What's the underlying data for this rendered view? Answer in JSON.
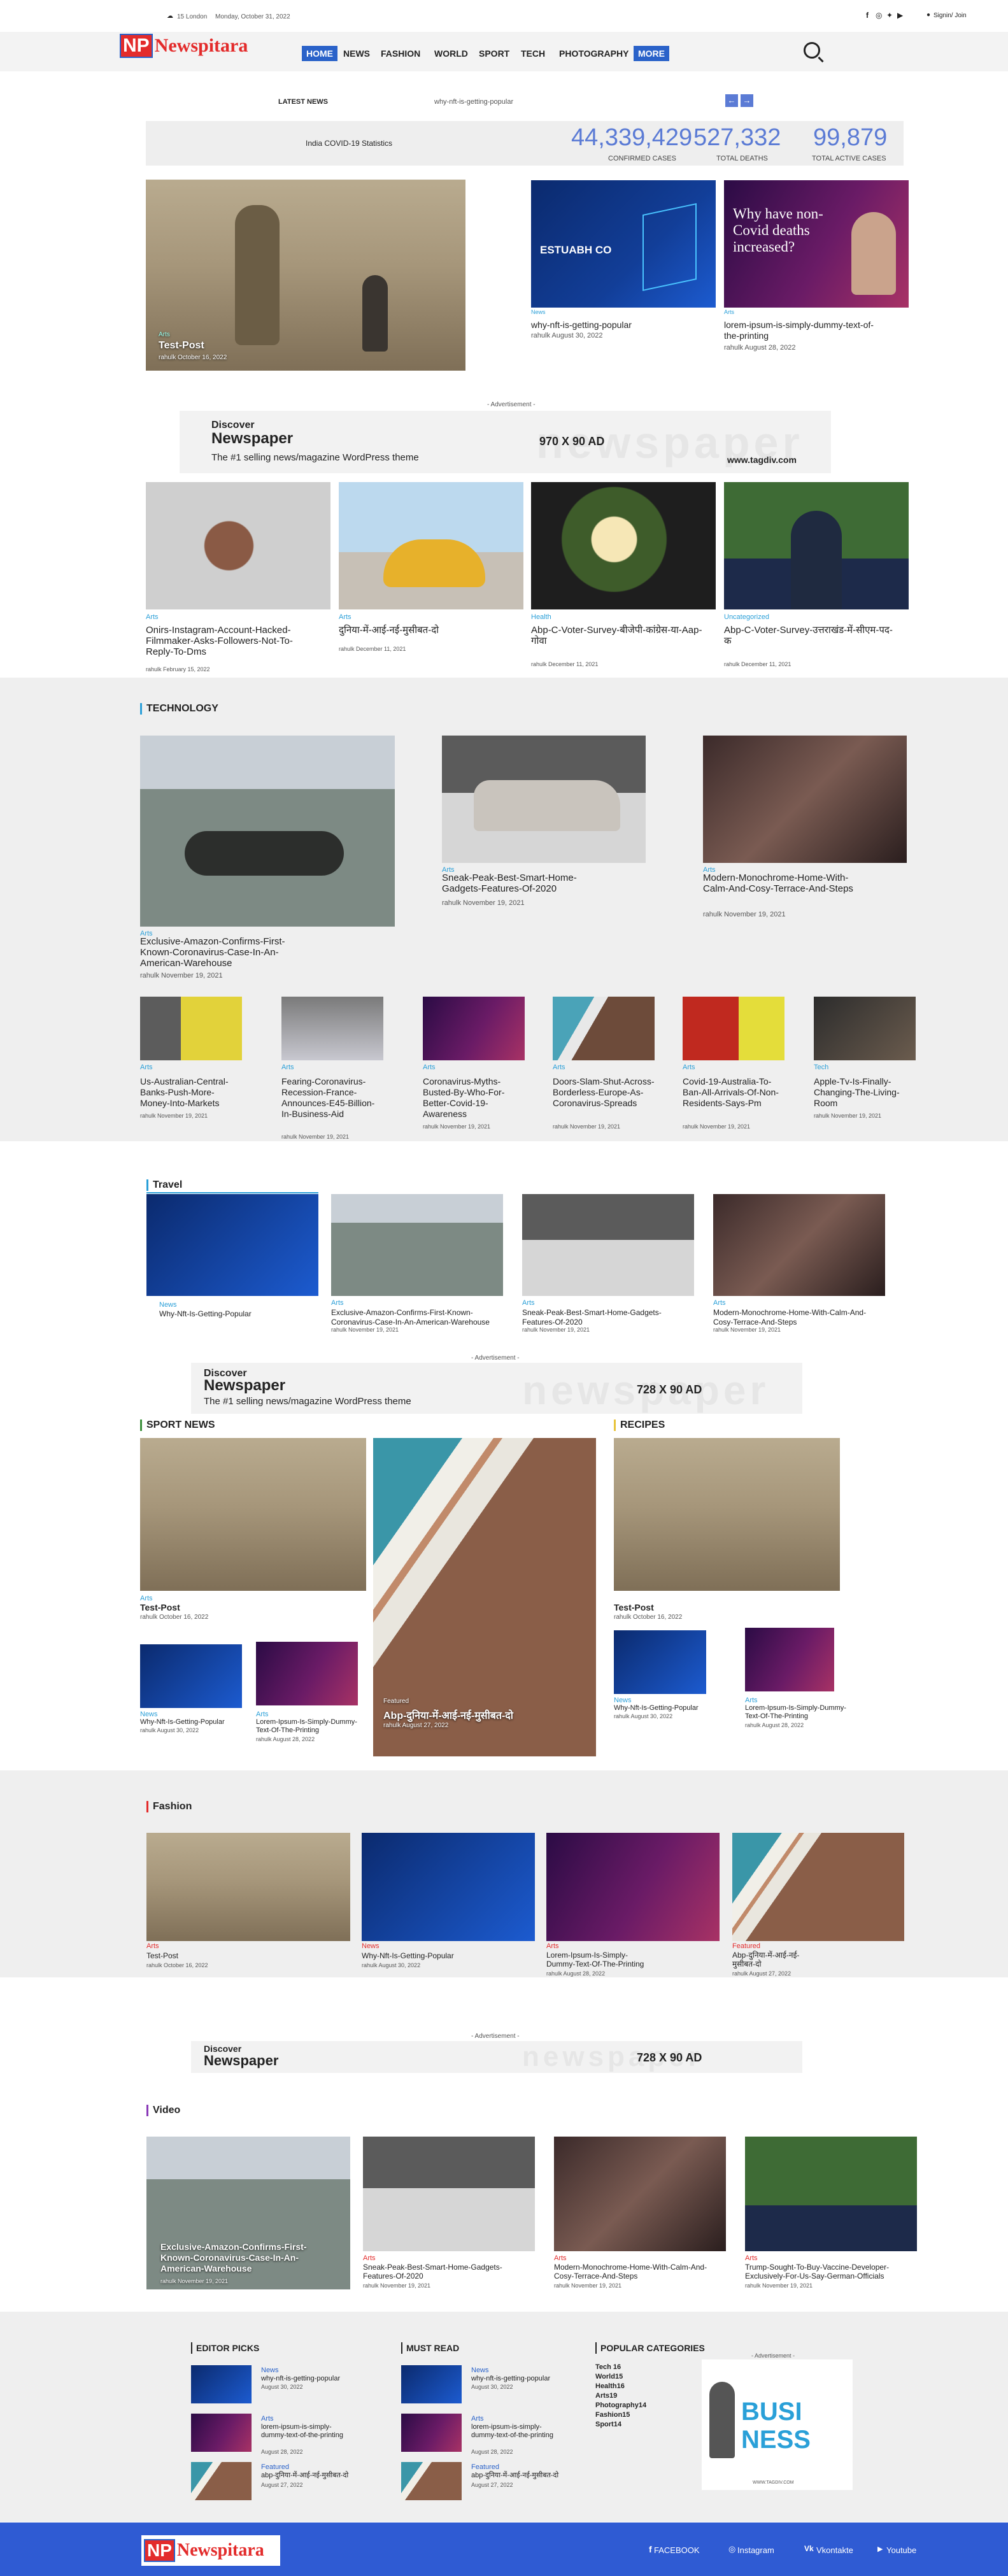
{
  "topbar": {
    "weather": "15 London",
    "date": "Monday, October 31, 2022",
    "signin": "Signin/ Join"
  },
  "brand": {
    "np": "NP",
    "name": "Newspitara"
  },
  "nav": [
    "HOME",
    "NEWS",
    "FASHION",
    "WORLD",
    "SPORT",
    "TECH",
    "PHOTOGRAPHY",
    "MORE"
  ],
  "ticker": {
    "label": "LATEST NEWS",
    "text": "why-nft-is-getting-popular"
  },
  "covid": {
    "title": "India COVID-19 Statistics",
    "stats": [
      {
        "value": "44,339,429",
        "label": "CONFIRMED CASES"
      },
      {
        "value": "527,332",
        "label": "TOTAL DEATHS"
      },
      {
        "value": "99,879",
        "label": "TOTAL ACTIVE CASES"
      }
    ]
  },
  "hero": {
    "main": {
      "cat": "Arts",
      "title": "Test-Post",
      "meta": "rahulk October 16, 2022"
    },
    "side": [
      {
        "cat": "News",
        "title": "why-nft-is-getting-popular",
        "meta": "rahulk August 30, 2022"
      },
      {
        "cat": "Arts",
        "title": "lorem-ipsum-is-simply-dummy-text-of-the-printing",
        "meta": "rahulk August 28, 2022"
      }
    ]
  },
  "ad": {
    "label": "- Advertisement -",
    "discover": "Discover",
    "newspaper": "Newspaper",
    "tagline": "The #1 selling news/magazine WordPress theme",
    "size1": "970 X 90 AD",
    "site": "www.tagdiv.com",
    "size2": "728 X 90 AD"
  },
  "row4": [
    {
      "cat": "Arts",
      "title": "Onirs-Instagram-Account-Hacked-Filmmaker-Asks-Followers-Not-To-Reply-To-Dms",
      "meta": "rahulk February 15, 2022"
    },
    {
      "cat": "Arts",
      "title": "दुनिया-में-आई-नई-मुसीबत-दो",
      "meta": "rahulk December 11, 2021"
    },
    {
      "cat": "Health",
      "title": "Abp-C-Voter-Survey-बीजेपी-कांग्रेस-या-Aap-गोवा",
      "meta": "rahulk December 11, 2021"
    },
    {
      "cat": "Uncategorized",
      "title": "Abp-C-Voter-Survey-उत्तराखंड-में-सीएम-पद-क",
      "meta": "rahulk December 11, 2021"
    }
  ],
  "technology": {
    "heading": "TECHNOLOGY",
    "top": [
      {
        "cat": "Arts",
        "title": "Exclusive-Amazon-Confirms-First-Known-Coronavirus-Case-In-An-American-Warehouse",
        "meta": "rahulk November 19, 2021"
      },
      {
        "cat": "Arts",
        "title": "Sneak-Peak-Best-Smart-Home-Gadgets-Features-Of-2020",
        "meta": "rahulk November 19, 2021"
      },
      {
        "cat": "Arts",
        "title": "Modern-Monochrome-Home-With-Calm-And-Cosy-Terrace-And-Steps",
        "meta": "rahulk November 19, 2021"
      }
    ],
    "small": [
      {
        "cat": "Arts",
        "title": "Us-Australian-Central-Banks-Push-More-Money-Into-Markets",
        "meta": "rahulk November 19, 2021"
      },
      {
        "cat": "Arts",
        "title": "Fearing-Coronavirus-Recession-France-Announces-E45-Billion-In-Business-Aid",
        "meta": "rahulk November 19, 2021"
      },
      {
        "cat": "Arts",
        "title": "Coronavirus-Myths-Busted-By-Who-For-Better-Covid-19-Awareness",
        "meta": "rahulk November 19, 2021"
      },
      {
        "cat": "Arts",
        "title": "Doors-Slam-Shut-Across-Borderless-Europe-As-Coronavirus-Spreads",
        "meta": "rahulk November 19, 2021"
      },
      {
        "cat": "Arts",
        "title": "Covid-19-Australia-To-Ban-All-Arrivals-Of-Non-Residents-Says-Pm",
        "meta": "rahulk November 19, 2021"
      },
      {
        "cat": "Tech",
        "title": "Apple-Tv-Is-Finally-Changing-The-Living-Room",
        "meta": "rahulk November 19, 2021"
      }
    ]
  },
  "travel": {
    "heading": "Travel",
    "items": [
      {
        "cat": "News",
        "title": "Why-Nft-Is-Getting-Popular",
        "meta": ""
      },
      {
        "cat": "Arts",
        "title": "Exclusive-Amazon-Confirms-First-Known-Coronavirus-Case-In-An-American-Warehouse",
        "meta": "rahulk November 19, 2021"
      },
      {
        "cat": "Arts",
        "title": "Sneak-Peak-Best-Smart-Home-Gadgets-Features-Of-2020",
        "meta": "rahulk November 19, 2021"
      },
      {
        "cat": "Arts",
        "title": "Modern-Monochrome-Home-With-Calm-And-Cosy-Terrace-And-Steps",
        "meta": "rahulk November 19, 2021"
      }
    ]
  },
  "sport": {
    "heading": "SPORT NEWS",
    "main": {
      "cat": "Arts",
      "title": "Test-Post",
      "meta": "rahulk October 16, 2022"
    },
    "feature": {
      "cat": "Featured",
      "title": "Abp-दुनिया-में-आई-नई-मुसीबत-दो",
      "meta": "rahulk August 27, 2022"
    },
    "small": [
      {
        "cat": "News",
        "title": "Why-Nft-Is-Getting-Popular",
        "meta": "rahulk August 30, 2022"
      },
      {
        "cat": "Arts",
        "title": "Lorem-Ipsum-Is-Simply-Dummy-Text-Of-The-Printing",
        "meta": "rahulk August 28, 2022"
      }
    ]
  },
  "recipes": {
    "heading": "RECIPES",
    "main": {
      "cat": "Arts",
      "title": "Test-Post",
      "meta": "rahulk October 16, 2022"
    },
    "small": [
      {
        "cat": "News",
        "title": "Why-Nft-Is-Getting-Popular",
        "meta": "rahulk August 30, 2022"
      },
      {
        "cat": "Arts",
        "title": "Lorem-Ipsum-Is-Simply-Dummy-Text-Of-The-Printing",
        "meta": "rahulk August 28, 2022"
      }
    ]
  },
  "fashion": {
    "heading": "Fashion",
    "items": [
      {
        "cat": "Arts",
        "title": "Test-Post",
        "meta": "rahulk October 16, 2022"
      },
      {
        "cat": "News",
        "title": "Why-Nft-Is-Getting-Popular",
        "meta": "rahulk August 30, 2022"
      },
      {
        "cat": "Arts",
        "title": "Lorem-Ipsum-Is-Simply-Dummy-Text-Of-The-Printing",
        "meta": "rahulk August 28, 2022"
      },
      {
        "cat": "Featured",
        "title": "Abp-दुनिया-में-आई-नई-मुसीबत-दो",
        "meta": "rahulk August 27, 2022"
      }
    ]
  },
  "video": {
    "heading": "Video",
    "items": [
      {
        "cat": "Arts",
        "title": "Exclusive-Amazon-Confirms-First-Known-Coronavirus-Case-In-An-American-Warehouse",
        "meta": "rahulk November 19, 2021"
      },
      {
        "cat": "Arts",
        "title": "Sneak-Peak-Best-Smart-Home-Gadgets-Features-Of-2020",
        "meta": "rahulk November 19, 2021"
      },
      {
        "cat": "Arts",
        "title": "Modern-Monochrome-Home-With-Calm-And-Cosy-Terrace-And-Steps",
        "meta": "rahulk November 19, 2021"
      },
      {
        "cat": "Arts",
        "title": "Trump-Sought-To-Buy-Vaccine-Developer-Exclusively-For-Us-Say-German-Officials",
        "meta": "rahulk November 19, 2021"
      }
    ]
  },
  "editor": {
    "heading": "EDITOR PICKS",
    "items": [
      {
        "cat": "News",
        "title": "why-nft-is-getting-popular",
        "meta": "August 30, 2022"
      },
      {
        "cat": "Arts",
        "title": "lorem-ipsum-is-simply-dummy-text-of-the-printing",
        "meta": "August 28, 2022"
      },
      {
        "cat": "Featured",
        "title": "abp-दुनिया-में-आई-नई-मुसीबत-दो",
        "meta": "August 27, 2022"
      }
    ]
  },
  "mustread": {
    "heading": "MUST READ",
    "items": [
      {
        "cat": "News",
        "title": "why-nft-is-getting-popular",
        "meta": "August 30, 2022"
      },
      {
        "cat": "Arts",
        "title": "lorem-ipsum-is-simply-dummy-text-of-the-printing",
        "meta": "August 28, 2022"
      },
      {
        "cat": "Featured",
        "title": "abp-दुनिया-में-आई-नई-मुसीबत-दो",
        "meta": "August 27, 2022"
      }
    ]
  },
  "popular": {
    "heading": "POPULAR CATEGORIES",
    "items": [
      "Tech 16",
      "World15",
      "Health16",
      "Arts19",
      "Photography14",
      "Fashion15",
      "Sport14"
    ]
  },
  "sideAd": {
    "label": "- Advertisement -",
    "word": "BUSINESS",
    "site": "WWW.TAGDIV.COM"
  },
  "footer": {
    "links": [
      "FACEBOOK",
      "Instagram",
      "Vkontakte",
      "Youtube"
    ]
  },
  "colors": {
    "accent": "#2a9fd8",
    "nav": "#2a62c9",
    "footer": "#2f5bd3",
    "logo": "#e32b2b"
  }
}
